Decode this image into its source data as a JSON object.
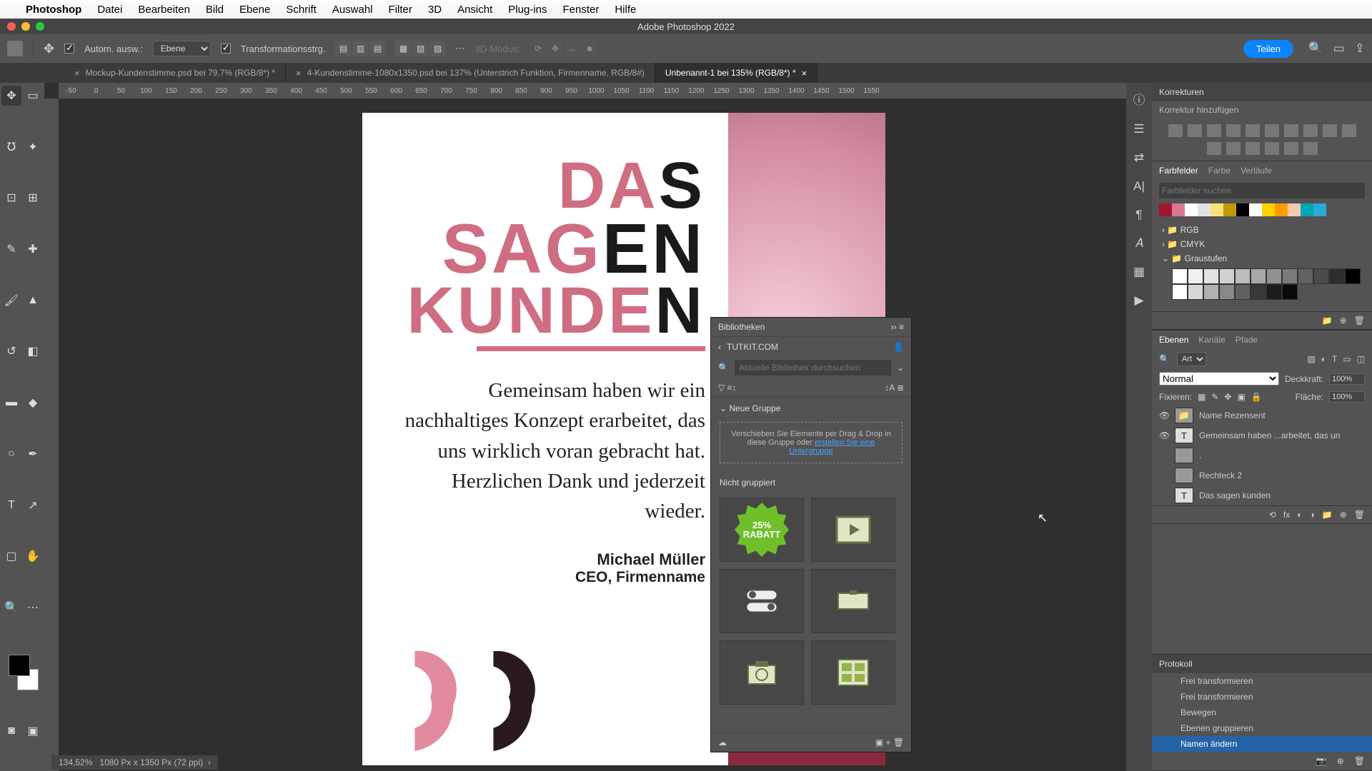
{
  "mac_menu": {
    "app": "Photoshop",
    "items": [
      "Datei",
      "Bearbeiten",
      "Bild",
      "Ebene",
      "Schrift",
      "Auswahl",
      "Filter",
      "3D",
      "Ansicht",
      "Plug-ins",
      "Fenster",
      "Hilfe"
    ]
  },
  "title_bar": {
    "title": "Adobe Photoshop 2022"
  },
  "options": {
    "auto_select": "Autom. ausw.:",
    "layer_combo": "Ebene",
    "transform": "Transformationsstrg.",
    "mode3d": "3D-Modus:",
    "share": "Teilen"
  },
  "tabs": [
    {
      "label": "Mockup-Kundenstimme.psd bei 79,7% (RGB/8*) *"
    },
    {
      "label": "4-Kundenstimme-1080x1350.psd bei 137% (Unterstrich Funktion, Firmenname, RGB/8#)"
    },
    {
      "label": "Unbenannt-1 bei 135% (RGB/8*) *",
      "active": true
    }
  ],
  "ruler": [
    "-50",
    "0",
    "50",
    "100",
    "150",
    "200",
    "250",
    "300",
    "350",
    "400",
    "450",
    "500",
    "550",
    "600",
    "650",
    "700",
    "750",
    "800",
    "850",
    "900",
    "950",
    "1000",
    "1050",
    "1100",
    "1150",
    "1200",
    "1250",
    "1300",
    "1350",
    "1400",
    "1450",
    "1500",
    "1550"
  ],
  "artboard": {
    "hl1a": "DA",
    "hl1b": "S",
    "hl2a": "SAG",
    "hl2b": "EN",
    "hl3a": "KUNDE",
    "hl3b": "N",
    "quote": "Gemeinsam haben wir ein nachhaltiges Konzept erarbeitet, das uns wirklich voran gebracht hat. Herzlichen Dank und jederzeit wieder.",
    "author_name": "Michael Müller",
    "author_role": "CEO, Firmenname"
  },
  "libraries": {
    "title": "Bibliotheken",
    "source": "TUTKIT.COM",
    "search_ph": "Aktuelle Bibliothek durchsuchen",
    "new_group": "Neue Gruppe",
    "drop_text": "Verschieben Sie Elemente per Drag & Drop in diese Gruppe oder ",
    "drop_link": "erstellen Sie eine Untergruppe",
    "ungrouped": "Nicht gruppiert",
    "star": "25%\nRABATT"
  },
  "right": {
    "adj_title": "Korrekturen",
    "adj_add": "Korrektur hinzufügen",
    "sw_tabs": [
      "Farbfelder",
      "Farbe",
      "Verläufe"
    ],
    "sw_search_ph": "Farbfelder suchen",
    "sw_groups": [
      "RGB",
      "CMYK",
      "Graustufen"
    ],
    "swatches_row": [
      "#a01830",
      "#d97797",
      "#ffffff",
      "#e3e3e3",
      "#f7e27a",
      "#c49a00",
      "#000000",
      "#ffffff",
      "#ffd400",
      "#ff9c00",
      "#f5c9b0",
      "#00a6b5",
      "#2aa9d8"
    ],
    "grayscale": [
      "#ffffff",
      "#f0f0f0",
      "#e2e2e2",
      "#d0d0d0",
      "#bcbcbc",
      "#a8a8a8",
      "#929292",
      "#7a7a7a",
      "#626262",
      "#4a4a4a",
      "#2e2e2e",
      "#000000",
      "#ffffff",
      "#d8d8d8",
      "#b0b0b0",
      "#888888",
      "#606060",
      "#383838",
      "#1c1c1c",
      "#0a0a0a"
    ],
    "ly_tabs": [
      "Ebenen",
      "Kanäle",
      "Pfade"
    ],
    "ly_kind": "Art",
    "ly_blend": "Normal",
    "ly_opacity_lbl": "Deckkraft:",
    "ly_opacity": "100%",
    "ly_lock": "Fixieren:",
    "ly_fill_lbl": "Fläche:",
    "ly_fill": "100%",
    "layers": [
      {
        "vis": true,
        "type": "grp",
        "name": "Name Rezensent"
      },
      {
        "vis": true,
        "type": "txt",
        "name": "Gemeinsam haben ...arbeitet, das un"
      },
      {
        "vis": false,
        "type": "shape",
        "name": "."
      },
      {
        "vis": false,
        "type": "shape",
        "name": "Rechteck 2"
      },
      {
        "vis": false,
        "type": "txt",
        "name": "Das  sagen kunden"
      }
    ],
    "history_title": "Protokoll",
    "history": [
      "Frei transformieren",
      "Frei transformieren",
      "Bewegen",
      "Ebenen gruppieren",
      "Namen ändern"
    ]
  },
  "status": {
    "zoom": "134,52%",
    "dims": "1080 Px x 1350 Px (72 ppi)"
  }
}
